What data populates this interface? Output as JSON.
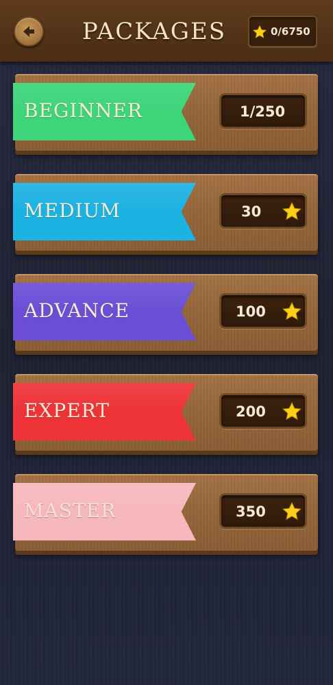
{
  "header": {
    "title": "PACKAGES",
    "stars_total": "0/6750",
    "back_icon": "back-arrow-icon"
  },
  "packages": [
    {
      "name": "BEGINNER",
      "value": "1/250",
      "color": "#3ed57a",
      "show_star": false
    },
    {
      "name": "MEDIUM",
      "value": "30",
      "color": "#1cb2e2",
      "show_star": true
    },
    {
      "name": "ADVANCE",
      "value": "100",
      "color": "#6a4fd6",
      "show_star": true
    },
    {
      "name": "EXPERT",
      "value": "200",
      "color": "#ee3338",
      "show_star": true
    },
    {
      "name": "MASTER",
      "value": "350",
      "color": "#f7b8bd",
      "show_star": true
    }
  ],
  "colors": {
    "star": "#f9cf1a",
    "header_bg": "#4e2f16",
    "page_bg": "#1e2234"
  }
}
